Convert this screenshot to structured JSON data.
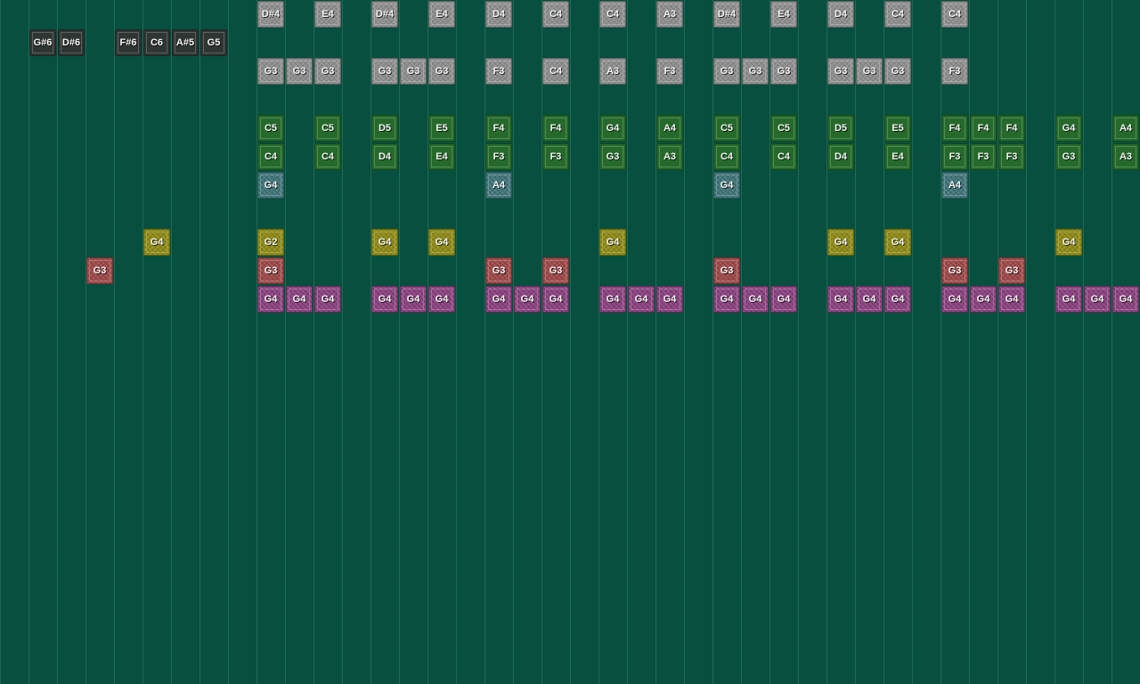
{
  "colors": {
    "background": "#074f3e",
    "gray": "#8e8e8e",
    "dark": "#2f3533",
    "green": "#256a2b",
    "teal": "#3d7478",
    "yellow": "#8e8a12",
    "red": "#9e4646",
    "purple": "#8a3f7e"
  },
  "tracks": [
    {
      "name": "gray-top",
      "color": "gray",
      "row": 0,
      "notes": [
        {
          "col": 9,
          "label": "D#4"
        },
        {
          "col": 11,
          "label": "E4"
        },
        {
          "col": 13,
          "label": "D#4"
        },
        {
          "col": 15,
          "label": "E4"
        },
        {
          "col": 17,
          "label": "D4"
        },
        {
          "col": 19,
          "label": "C4"
        },
        {
          "col": 21,
          "label": "C4"
        },
        {
          "col": 23,
          "label": "A3"
        },
        {
          "col": 25,
          "label": "D#4"
        },
        {
          "col": 27,
          "label": "E4"
        },
        {
          "col": 29,
          "label": "D4"
        },
        {
          "col": 31,
          "label": "C4"
        },
        {
          "col": 33,
          "label": "C4"
        }
      ]
    },
    {
      "name": "dark",
      "color": "dark",
      "row": 1,
      "notes": [
        {
          "col": 1,
          "label": "G#6"
        },
        {
          "col": 2,
          "label": "D#6"
        },
        {
          "col": 4,
          "label": "F#6"
        },
        {
          "col": 5,
          "label": "C6"
        },
        {
          "col": 6,
          "label": "A#5"
        },
        {
          "col": 7,
          "label": "G5"
        }
      ]
    },
    {
      "name": "gray-bottom",
      "color": "gray",
      "row": 2,
      "notes": [
        {
          "col": 9,
          "label": "G3"
        },
        {
          "col": 10,
          "label": "G3"
        },
        {
          "col": 11,
          "label": "G3"
        },
        {
          "col": 13,
          "label": "G3"
        },
        {
          "col": 14,
          "label": "G3"
        },
        {
          "col": 15,
          "label": "G3"
        },
        {
          "col": 17,
          "label": "F3"
        },
        {
          "col": 19,
          "label": "C4"
        },
        {
          "col": 21,
          "label": "A3"
        },
        {
          "col": 23,
          "label": "F3"
        },
        {
          "col": 25,
          "label": "G3"
        },
        {
          "col": 26,
          "label": "G3"
        },
        {
          "col": 27,
          "label": "G3"
        },
        {
          "col": 29,
          "label": "G3"
        },
        {
          "col": 30,
          "label": "G3"
        },
        {
          "col": 31,
          "label": "G3"
        },
        {
          "col": 33,
          "label": "F3"
        }
      ]
    },
    {
      "name": "green-high",
      "color": "green",
      "row": 4,
      "notes": [
        {
          "col": 9,
          "label": "C5"
        },
        {
          "col": 11,
          "label": "C5"
        },
        {
          "col": 13,
          "label": "D5"
        },
        {
          "col": 15,
          "label": "E5"
        },
        {
          "col": 17,
          "label": "F4"
        },
        {
          "col": 19,
          "label": "F4"
        },
        {
          "col": 21,
          "label": "G4"
        },
        {
          "col": 23,
          "label": "A4"
        },
        {
          "col": 25,
          "label": "C5"
        },
        {
          "col": 27,
          "label": "C5"
        },
        {
          "col": 29,
          "label": "D5"
        },
        {
          "col": 31,
          "label": "E5"
        },
        {
          "col": 33,
          "label": "F4"
        },
        {
          "col": 34,
          "label": "F4"
        },
        {
          "col": 35,
          "label": "F4"
        },
        {
          "col": 37,
          "label": "G4"
        },
        {
          "col": 39,
          "label": "A4"
        }
      ]
    },
    {
      "name": "green-low",
      "color": "green",
      "row": 5,
      "notes": [
        {
          "col": 9,
          "label": "C4"
        },
        {
          "col": 11,
          "label": "C4"
        },
        {
          "col": 13,
          "label": "D4"
        },
        {
          "col": 15,
          "label": "E4"
        },
        {
          "col": 17,
          "label": "F3"
        },
        {
          "col": 19,
          "label": "F3"
        },
        {
          "col": 21,
          "label": "G3"
        },
        {
          "col": 23,
          "label": "A3"
        },
        {
          "col": 25,
          "label": "C4"
        },
        {
          "col": 27,
          "label": "C4"
        },
        {
          "col": 29,
          "label": "D4"
        },
        {
          "col": 31,
          "label": "E4"
        },
        {
          "col": 33,
          "label": "F3"
        },
        {
          "col": 34,
          "label": "F3"
        },
        {
          "col": 35,
          "label": "F3"
        },
        {
          "col": 37,
          "label": "G3"
        },
        {
          "col": 39,
          "label": "A3"
        }
      ]
    },
    {
      "name": "teal",
      "color": "teal",
      "row": 6,
      "notes": [
        {
          "col": 9,
          "label": "G4"
        },
        {
          "col": 17,
          "label": "A4"
        },
        {
          "col": 25,
          "label": "G4"
        },
        {
          "col": 33,
          "label": "A4"
        }
      ]
    },
    {
      "name": "yellow",
      "color": "yellow",
      "row": 8,
      "notes": [
        {
          "col": 5,
          "label": "G4"
        },
        {
          "col": 9,
          "label": "G2"
        },
        {
          "col": 13,
          "label": "G4"
        },
        {
          "col": 15,
          "label": "G4"
        },
        {
          "col": 21,
          "label": "G4"
        },
        {
          "col": 29,
          "label": "G4"
        },
        {
          "col": 31,
          "label": "G4"
        },
        {
          "col": 37,
          "label": "G4"
        }
      ]
    },
    {
      "name": "red",
      "color": "red",
      "row": 9,
      "notes": [
        {
          "col": 3,
          "label": "G3"
        },
        {
          "col": 9,
          "label": "G3"
        },
        {
          "col": 17,
          "label": "G3"
        },
        {
          "col": 19,
          "label": "G3"
        },
        {
          "col": 25,
          "label": "G3"
        },
        {
          "col": 33,
          "label": "G3"
        },
        {
          "col": 35,
          "label": "G3"
        }
      ]
    },
    {
      "name": "purple",
      "color": "purple",
      "row": 10,
      "notes": [
        {
          "col": 9,
          "label": "G4"
        },
        {
          "col": 10,
          "label": "G4"
        },
        {
          "col": 11,
          "label": "G4"
        },
        {
          "col": 13,
          "label": "G4"
        },
        {
          "col": 14,
          "label": "G4"
        },
        {
          "col": 15,
          "label": "G4"
        },
        {
          "col": 17,
          "label": "G4"
        },
        {
          "col": 18,
          "label": "G4"
        },
        {
          "col": 19,
          "label": "G4"
        },
        {
          "col": 21,
          "label": "G4"
        },
        {
          "col": 22,
          "label": "G4"
        },
        {
          "col": 23,
          "label": "G4"
        },
        {
          "col": 25,
          "label": "G4"
        },
        {
          "col": 26,
          "label": "G4"
        },
        {
          "col": 27,
          "label": "G4"
        },
        {
          "col": 29,
          "label": "G4"
        },
        {
          "col": 30,
          "label": "G4"
        },
        {
          "col": 31,
          "label": "G4"
        },
        {
          "col": 33,
          "label": "G4"
        },
        {
          "col": 34,
          "label": "G4"
        },
        {
          "col": 35,
          "label": "G4"
        },
        {
          "col": 37,
          "label": "G4"
        },
        {
          "col": 38,
          "label": "G4"
        },
        {
          "col": 39,
          "label": "G4"
        }
      ]
    }
  ]
}
